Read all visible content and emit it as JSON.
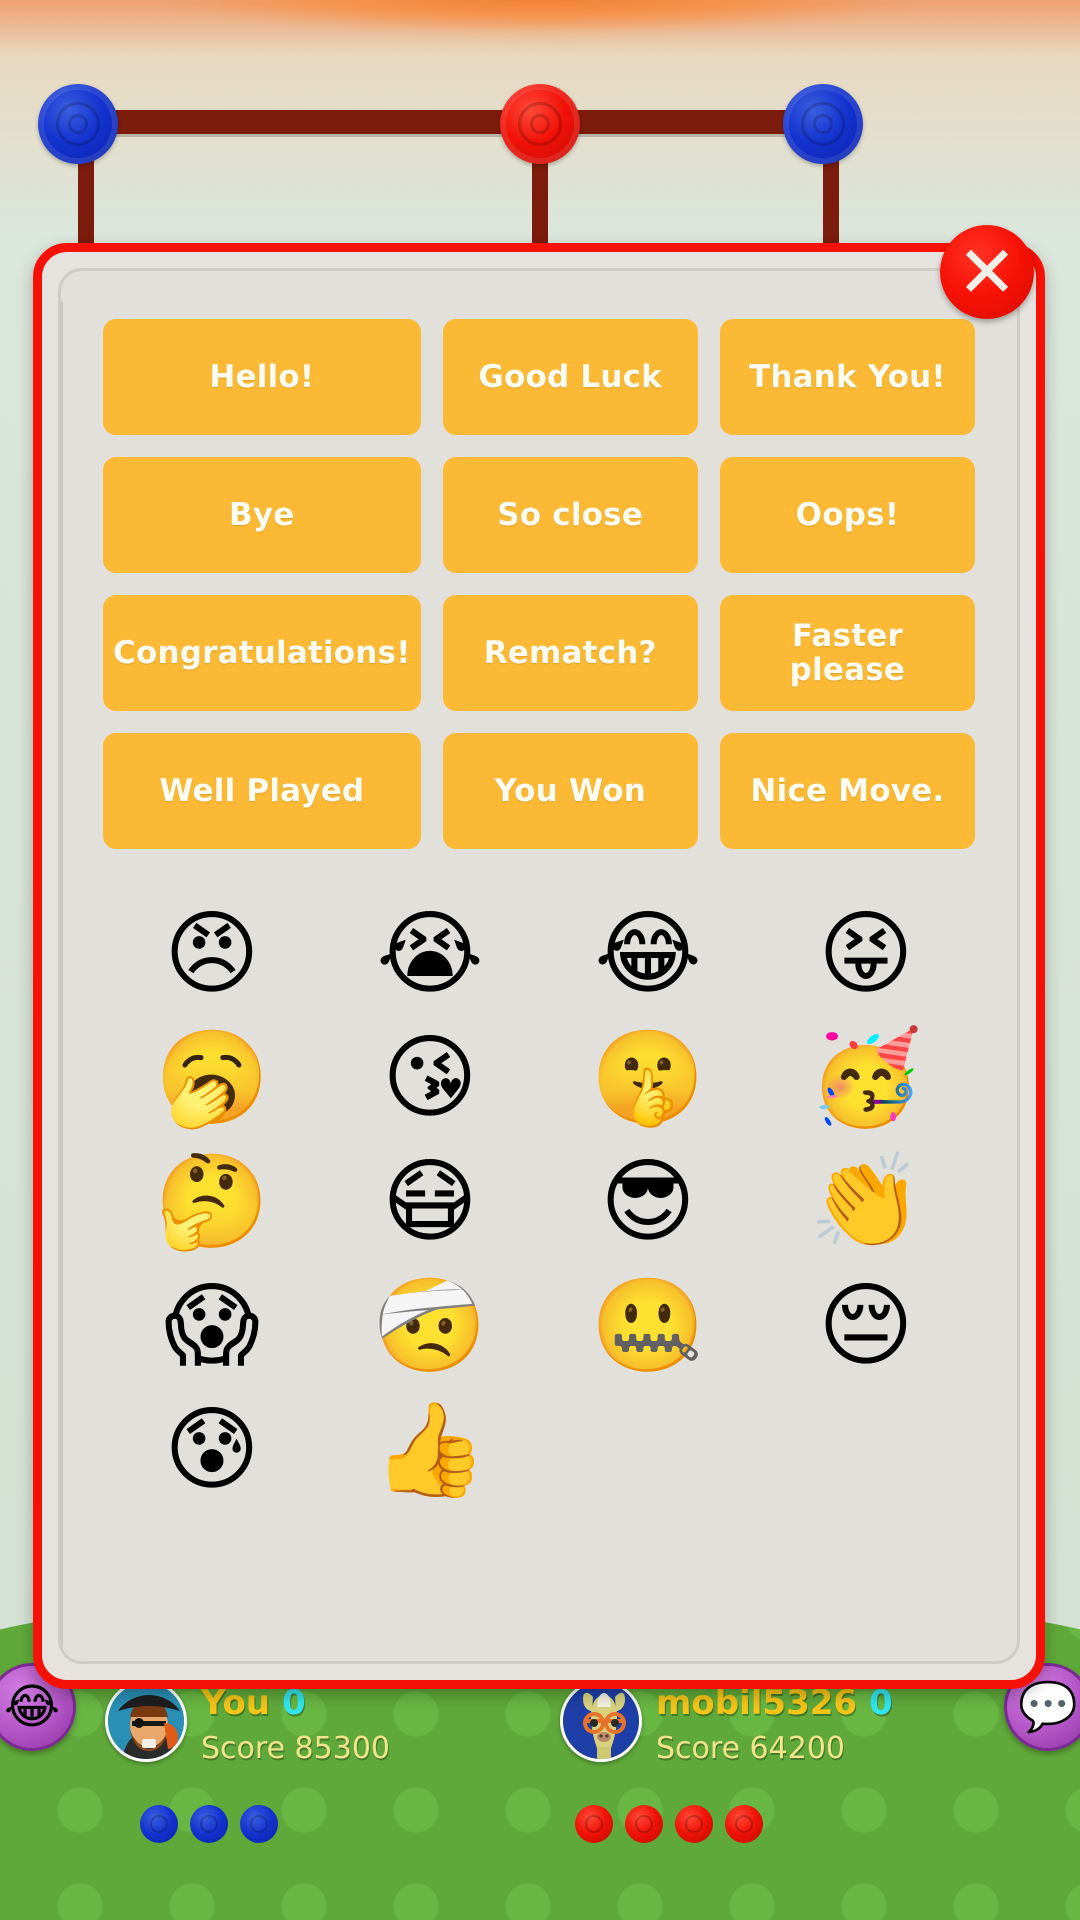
{
  "dialog": {
    "close_label": "✕",
    "messages": [
      "Hello!",
      "Good Luck",
      "Thank You!",
      "Bye",
      "So close",
      "Oops!",
      "Congratulations!",
      "Rematch?",
      "Faster please",
      "Well Played",
      "You Won",
      "Nice Move."
    ],
    "emojis": [
      {
        "name": "angry-face",
        "glyph": "😠"
      },
      {
        "name": "loudly-crying-face",
        "glyph": "😭"
      },
      {
        "name": "face-with-tears-of-joy",
        "glyph": "😂"
      },
      {
        "name": "squinting-face-with-tongue",
        "glyph": "😝"
      },
      {
        "name": "yawning-face",
        "glyph": "🥱"
      },
      {
        "name": "kissing-face-with-hearts",
        "glyph": "😘"
      },
      {
        "name": "shushing-face",
        "glyph": "🤫"
      },
      {
        "name": "partying-face",
        "glyph": "🥳"
      },
      {
        "name": "thinking-face",
        "glyph": "🤔"
      },
      {
        "name": "face-with-medical-mask",
        "glyph": "😷"
      },
      {
        "name": "smiling-face-with-sunglasses",
        "glyph": "😎"
      },
      {
        "name": "clapping-hands",
        "glyph": "👏"
      },
      {
        "name": "shocked-face-with-clock",
        "glyph": "😱"
      },
      {
        "name": "face-with-head-bandage",
        "glyph": "🤕"
      },
      {
        "name": "zipper-mouth-face",
        "glyph": "🤐"
      },
      {
        "name": "pensive-face",
        "glyph": "😔"
      },
      {
        "name": "anxious-face-with-sweat",
        "glyph": "😰"
      },
      {
        "name": "thumbs-up",
        "glyph": "👍"
      }
    ]
  },
  "hud": {
    "you": {
      "name": "You",
      "count": "0",
      "score_label": "Score 85300",
      "chips": 3,
      "chip_color": "#1333cf"
    },
    "opponent": {
      "name": "mobil5326",
      "count": "0",
      "score_label": "Score 64200",
      "chips": 4,
      "chip_color": "#ef1206"
    }
  },
  "side_buttons": {
    "emoji": "😂",
    "chat": "💬"
  },
  "colors": {
    "dialog_border": "#f51105",
    "message_button": "#fbb935",
    "message_text": "#fffdf2",
    "board_bar": "#7b1c0c",
    "peg_blue": "#1333cf",
    "peg_red": "#f11208",
    "ground": "#5fa93a",
    "name_text": "#f5c518",
    "count_text": "#2fe6f0",
    "score_text": "#f0e38a"
  }
}
